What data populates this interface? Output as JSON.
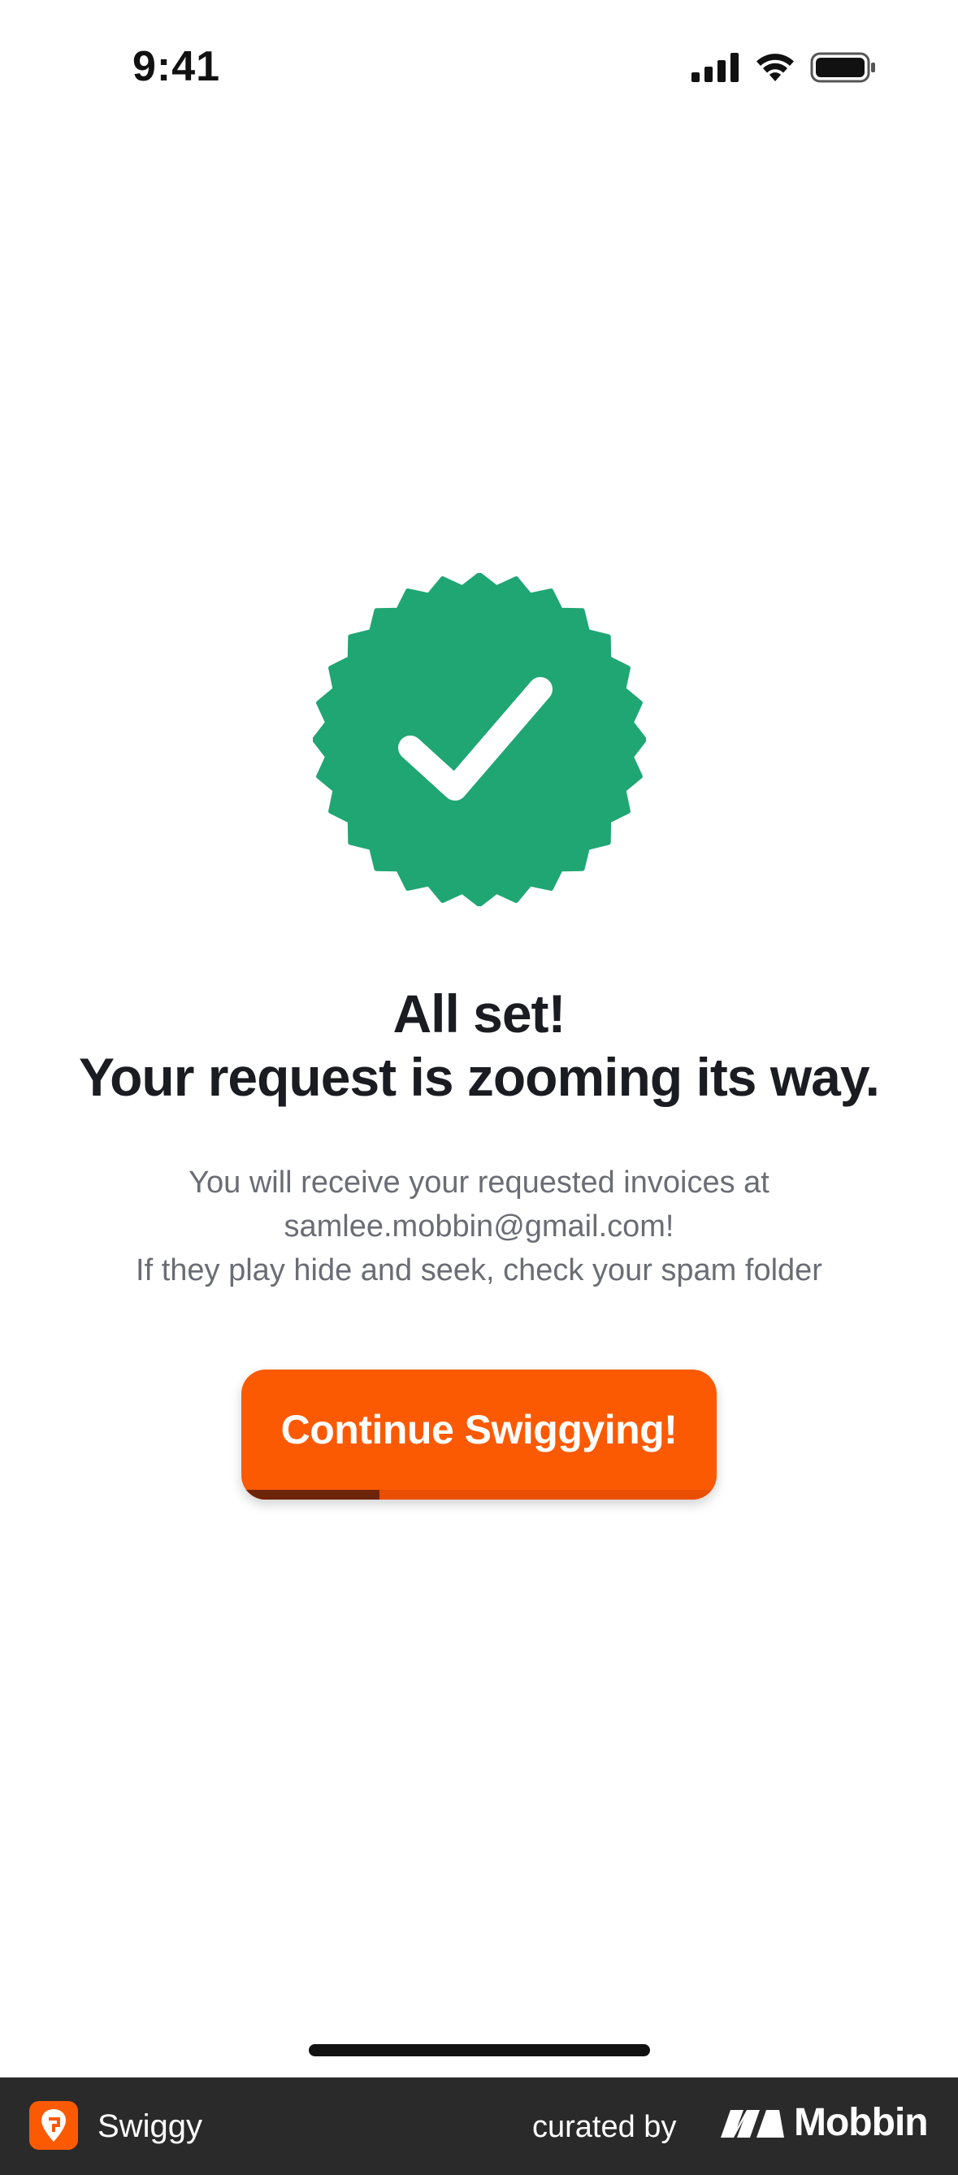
{
  "status_bar": {
    "time": "9:41",
    "icons": [
      "cellular-signal-icon",
      "wifi-icon",
      "battery-icon"
    ]
  },
  "badge": {
    "icon": "verified-check-badge-icon",
    "color": "#1fa673"
  },
  "headline": {
    "line1": "All set!",
    "line2": "Your request is zooming its way."
  },
  "message": {
    "line1": "You will receive your requested invoices at",
    "line2": "samlee.mobbin@gmail.com!",
    "line3": "If they play hide and seek, check your spam folder"
  },
  "cta": {
    "label": "Continue Swiggying!",
    "color": "#fc5a02",
    "progress": 0.29
  },
  "footer": {
    "app_name": "Swiggy",
    "curated_label": "curated by",
    "brand": "Mobbin"
  }
}
